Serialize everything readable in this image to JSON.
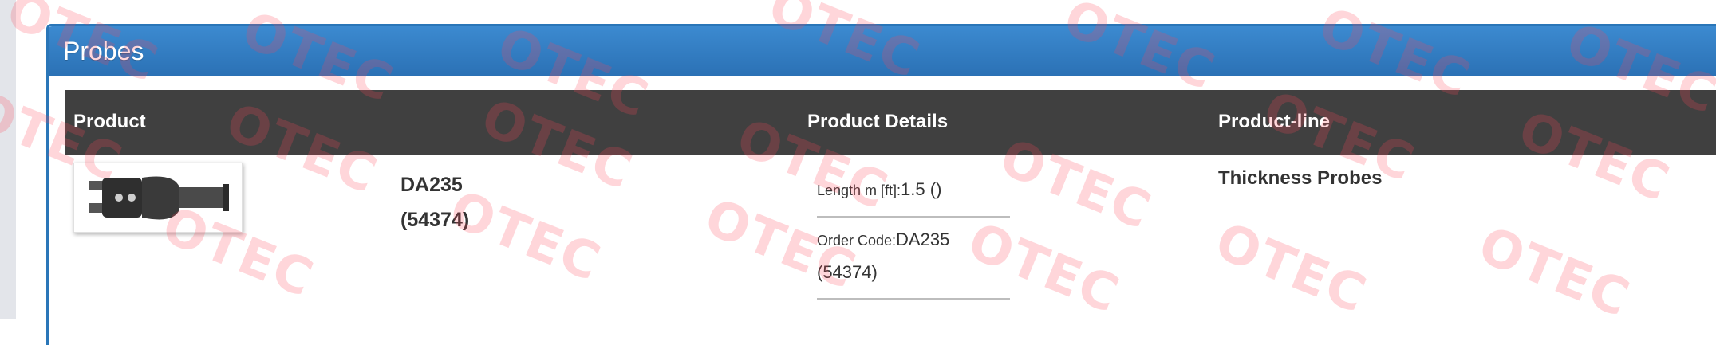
{
  "panel": {
    "title": "Probes"
  },
  "table": {
    "headers": [
      "Product",
      "Product Details",
      "Product-line"
    ],
    "rows": [
      {
        "product_name_line1": "DA235",
        "product_name_line2": "(54374)",
        "thumbnail_icon": "probe-connector-icon",
        "details": [
          {
            "key": "Length m [ft]:",
            "value": "1.5 ()"
          },
          {
            "key": "Order Code:",
            "value": "DA235",
            "value2": "(54374)"
          }
        ],
        "product_line": "Thickness Probes"
      }
    ]
  },
  "watermark": {
    "text": "OTEC"
  },
  "colors": {
    "header_blue": "#2b71b5",
    "table_header": "#404040",
    "watermark": "#ff4655"
  }
}
